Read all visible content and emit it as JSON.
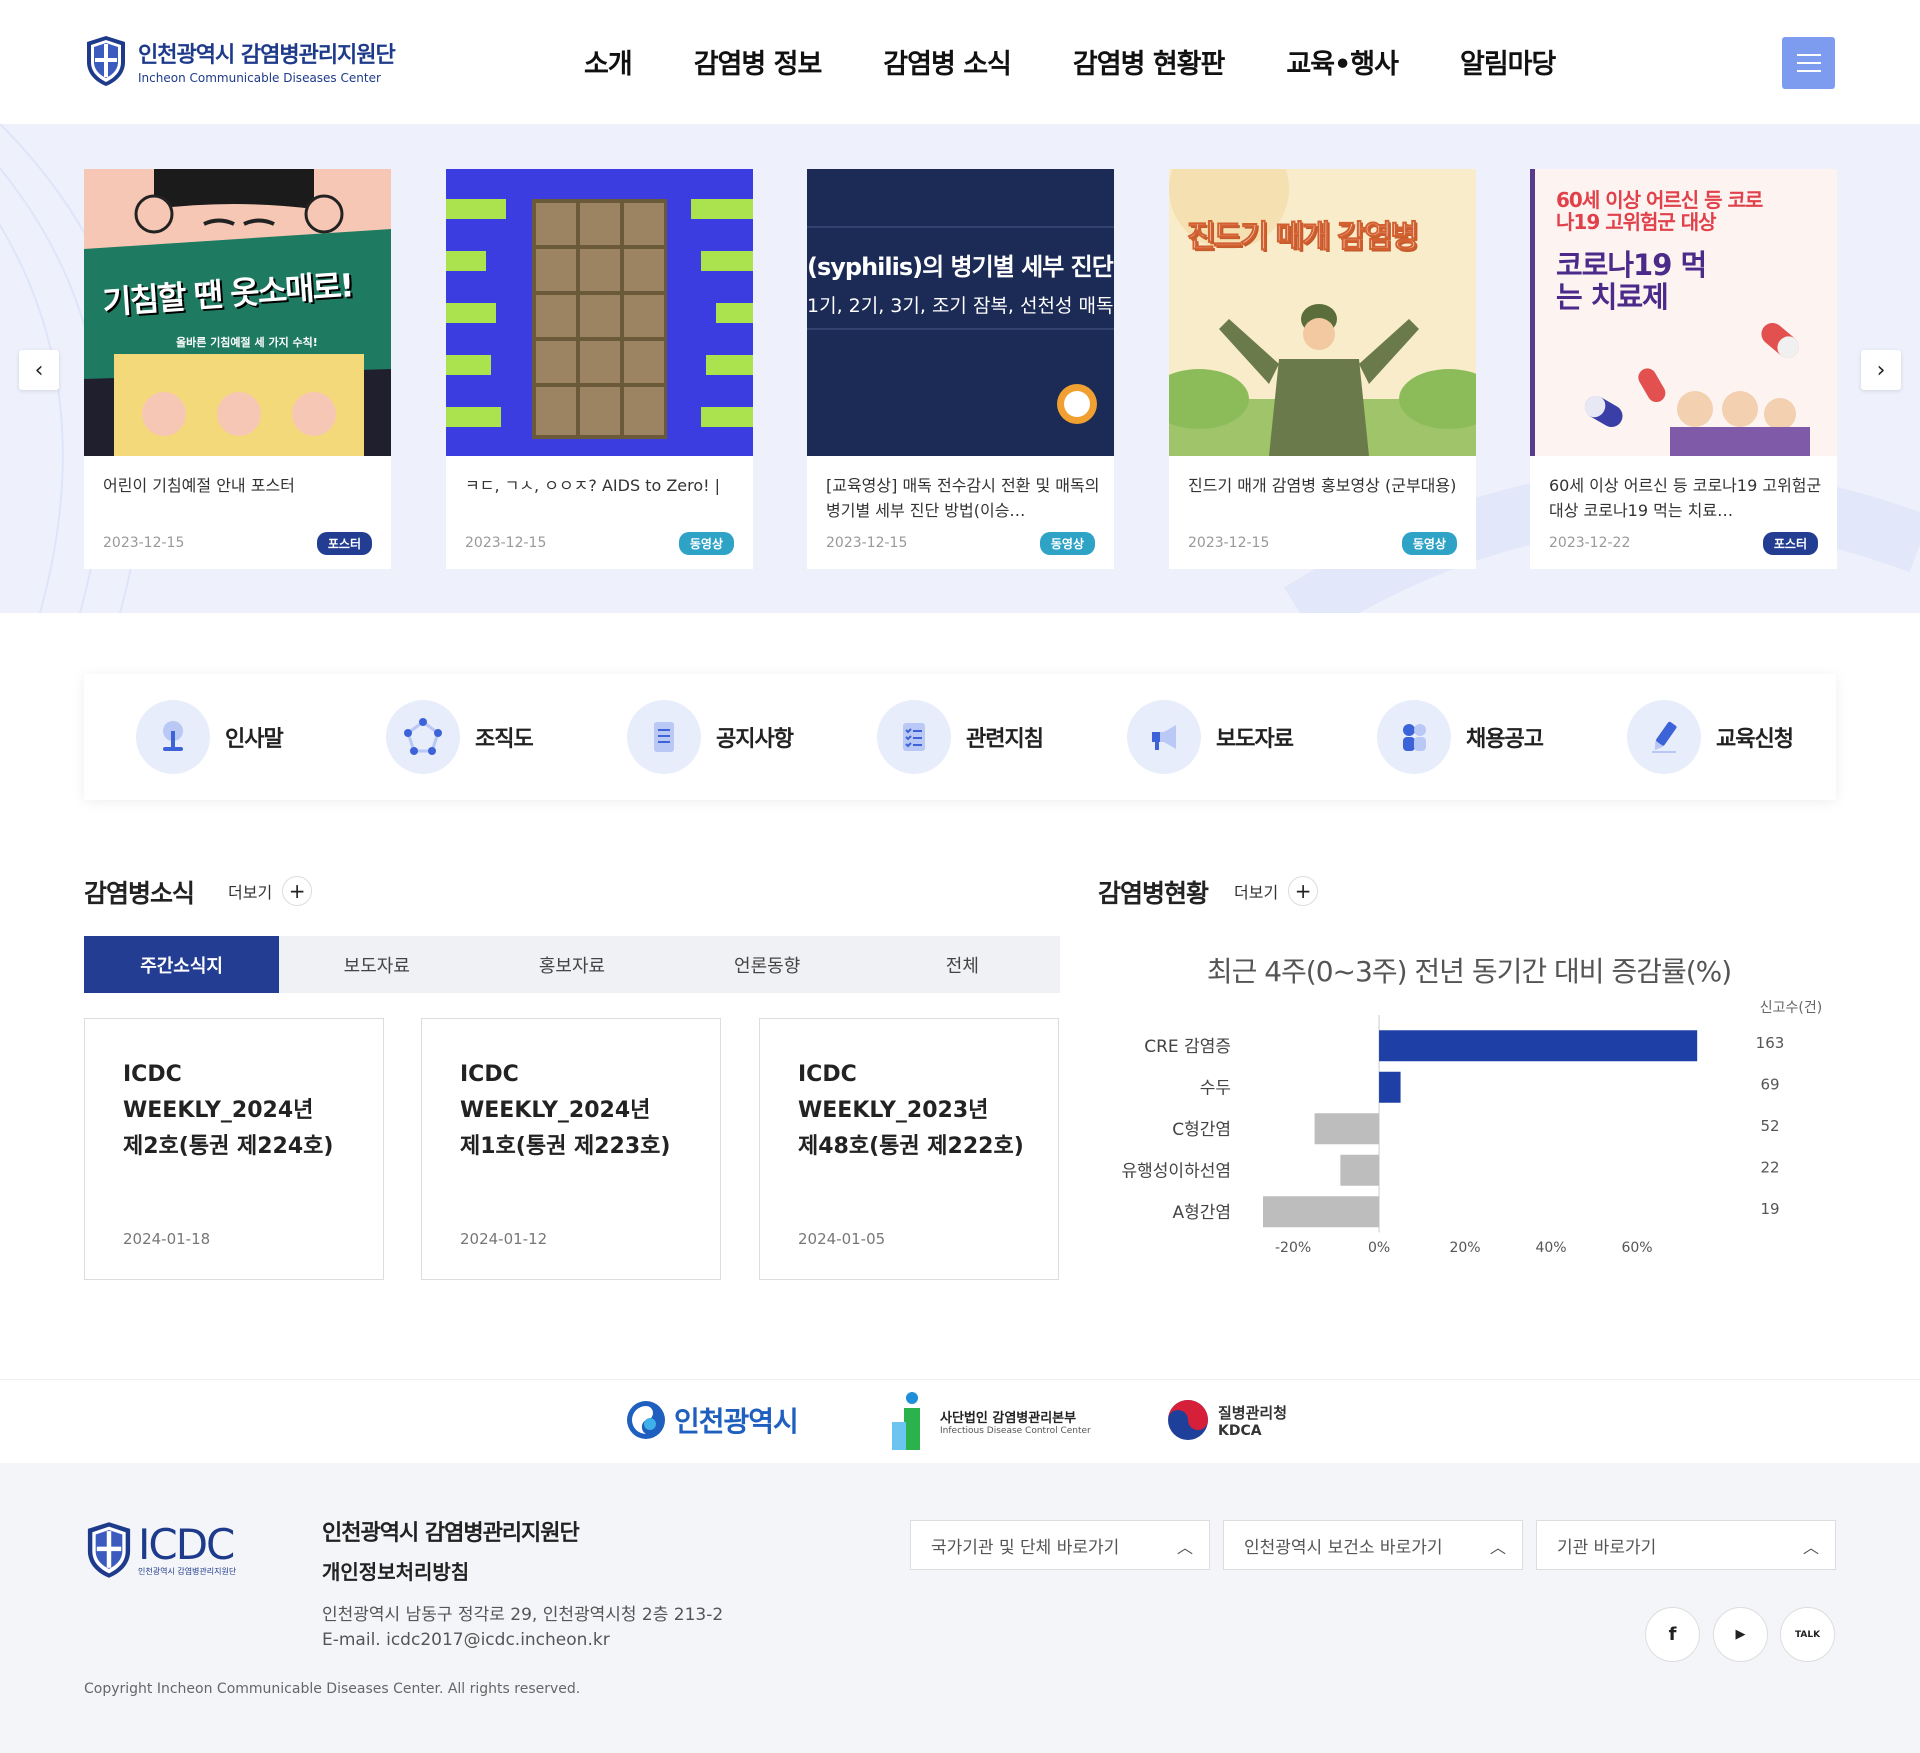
{
  "header": {
    "logo_ko": "인천광역시 감염병관리지원단",
    "logo_en": "Incheon Communicable Diseases Center",
    "nav": [
      "소개",
      "감염병 정보",
      "감염병 소식",
      "감염병 현황판",
      "교육•행사",
      "알림마당"
    ]
  },
  "slider": {
    "cards": [
      {
        "title": "어린이 기침예절 안내 포스터",
        "date": "2023-12-15",
        "badge": "포스터",
        "img_text": "기침할 땐 옷소매로!",
        "img_sub": "올바른 기침예절 세 가지 수칙!"
      },
      {
        "title": "ㅋㄷ, ㄱㅅ, ㅇㅇㅈ? AIDS to Zero! |",
        "date": "2023-12-15",
        "badge": "동영상",
        "img_text": "",
        "img_sub": ""
      },
      {
        "title": "[교육영상] 매독 전수감시 전환 및 매독의 병기별 세부 진단 방법(이승…",
        "date": "2023-12-15",
        "badge": "동영상",
        "img_text": "(syphilis)의 병기별 세부 진단",
        "img_sub": "1기, 2기, 3기, 조기 잠복, 선천성 매독"
      },
      {
        "title": "진드기 매개 감염병 홍보영상 (군부대용)",
        "date": "2023-12-15",
        "badge": "동영상",
        "img_text": "진드기 매개 감염병",
        "img_sub": ""
      },
      {
        "title": "60세 이상 어르신 등 코로나19 고위험군 대상 코로나19 먹는 치료…",
        "date": "2023-12-22",
        "badge": "포스터",
        "img_text": "코로나19 먹는 치료제",
        "img_sub": "60세 이상 어르신 등 코로나19 고위험군 대상"
      }
    ]
  },
  "quick_menu": [
    "인사말",
    "조직도",
    "공지사항",
    "관련지침",
    "보도자료",
    "채용공고",
    "교육신청"
  ],
  "news": {
    "title": "감염병소식",
    "more": "더보기",
    "tabs": [
      "주간소식지",
      "보도자료",
      "홍보자료",
      "언론동향",
      "전체"
    ],
    "items": [
      {
        "title": "ICDC\nWEEKLY_2024년\n제2호(통권 제224호)",
        "date": "2024-01-18"
      },
      {
        "title": "ICDC\nWEEKLY_2024년\n제1호(통권 제223호)",
        "date": "2024-01-12"
      },
      {
        "title": "ICDC\nWEEKLY_2023년\n제48호(통권 제222호)",
        "date": "2024-01-05"
      }
    ]
  },
  "status": {
    "title": "감염병현황",
    "more": "더보기"
  },
  "chart_data": {
    "type": "bar",
    "orientation": "horizontal",
    "title": "최근 4주(0~3주) 전년 동기간 대비 증감률(%)",
    "right_label": "신고수(건)",
    "categories": [
      "CRE 감염증",
      "수두",
      "C형간염",
      "유행성이하선염",
      "A형간염"
    ],
    "values": [
      74,
      5,
      -15,
      -9,
      -27
    ],
    "counts": [
      "163",
      "69",
      "52",
      "22",
      "19"
    ],
    "xlim": [
      -27,
      70
    ],
    "xticks": [
      -20,
      0,
      20,
      40,
      60
    ],
    "xtick_labels": [
      "-20%",
      "0%",
      "20%",
      "40%",
      "60%"
    ],
    "colors": {
      "positive": "#1e40a6",
      "negative": "#bdbdbd"
    }
  },
  "partners": [
    "인천광역시",
    "사단법인 감염병관리본부",
    "Infectious Disease Control Center",
    "질병관리청",
    "KDCA"
  ],
  "footer": {
    "logo": "ICDC",
    "logo_sub": "인천광역시 감염병관리지원단",
    "org": "인천광역시 감염병관리지원단",
    "privacy": "개인정보처리방침",
    "address": "인천광역시 남동구 정각로 29, 인천광역시청 2층 213-2",
    "email": "E-mail. icdc2017@icdc.incheon.kr",
    "copyright": "Copyright Incheon Communicable Diseases Center. All rights reserved.",
    "selects": [
      "국가기관 및 단체 바로가기",
      "인천광역시 보건소 바로가기",
      "기관 바로가기"
    ],
    "sns": [
      "f",
      "▶",
      "TALK"
    ]
  }
}
